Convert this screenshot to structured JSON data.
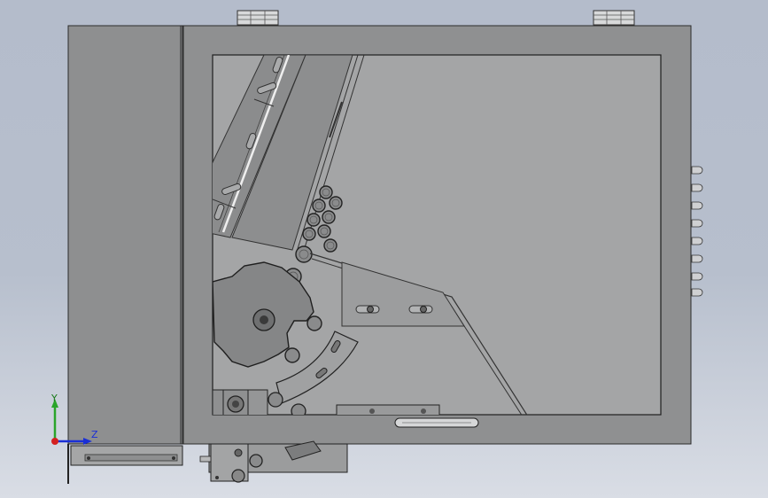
{
  "viewport": {
    "background_top": "#b4bccb",
    "background_bottom": "#d9dde5"
  },
  "triad": {
    "y_label": "Y",
    "z_label": "Z",
    "y_color": "#2aa52a",
    "z_color": "#1a2fd6",
    "x_color": "#d42020"
  },
  "model": {
    "panel_color": "#8f9091",
    "window_color": "#a3a4a5",
    "edge_color": "#2b2b2b"
  }
}
